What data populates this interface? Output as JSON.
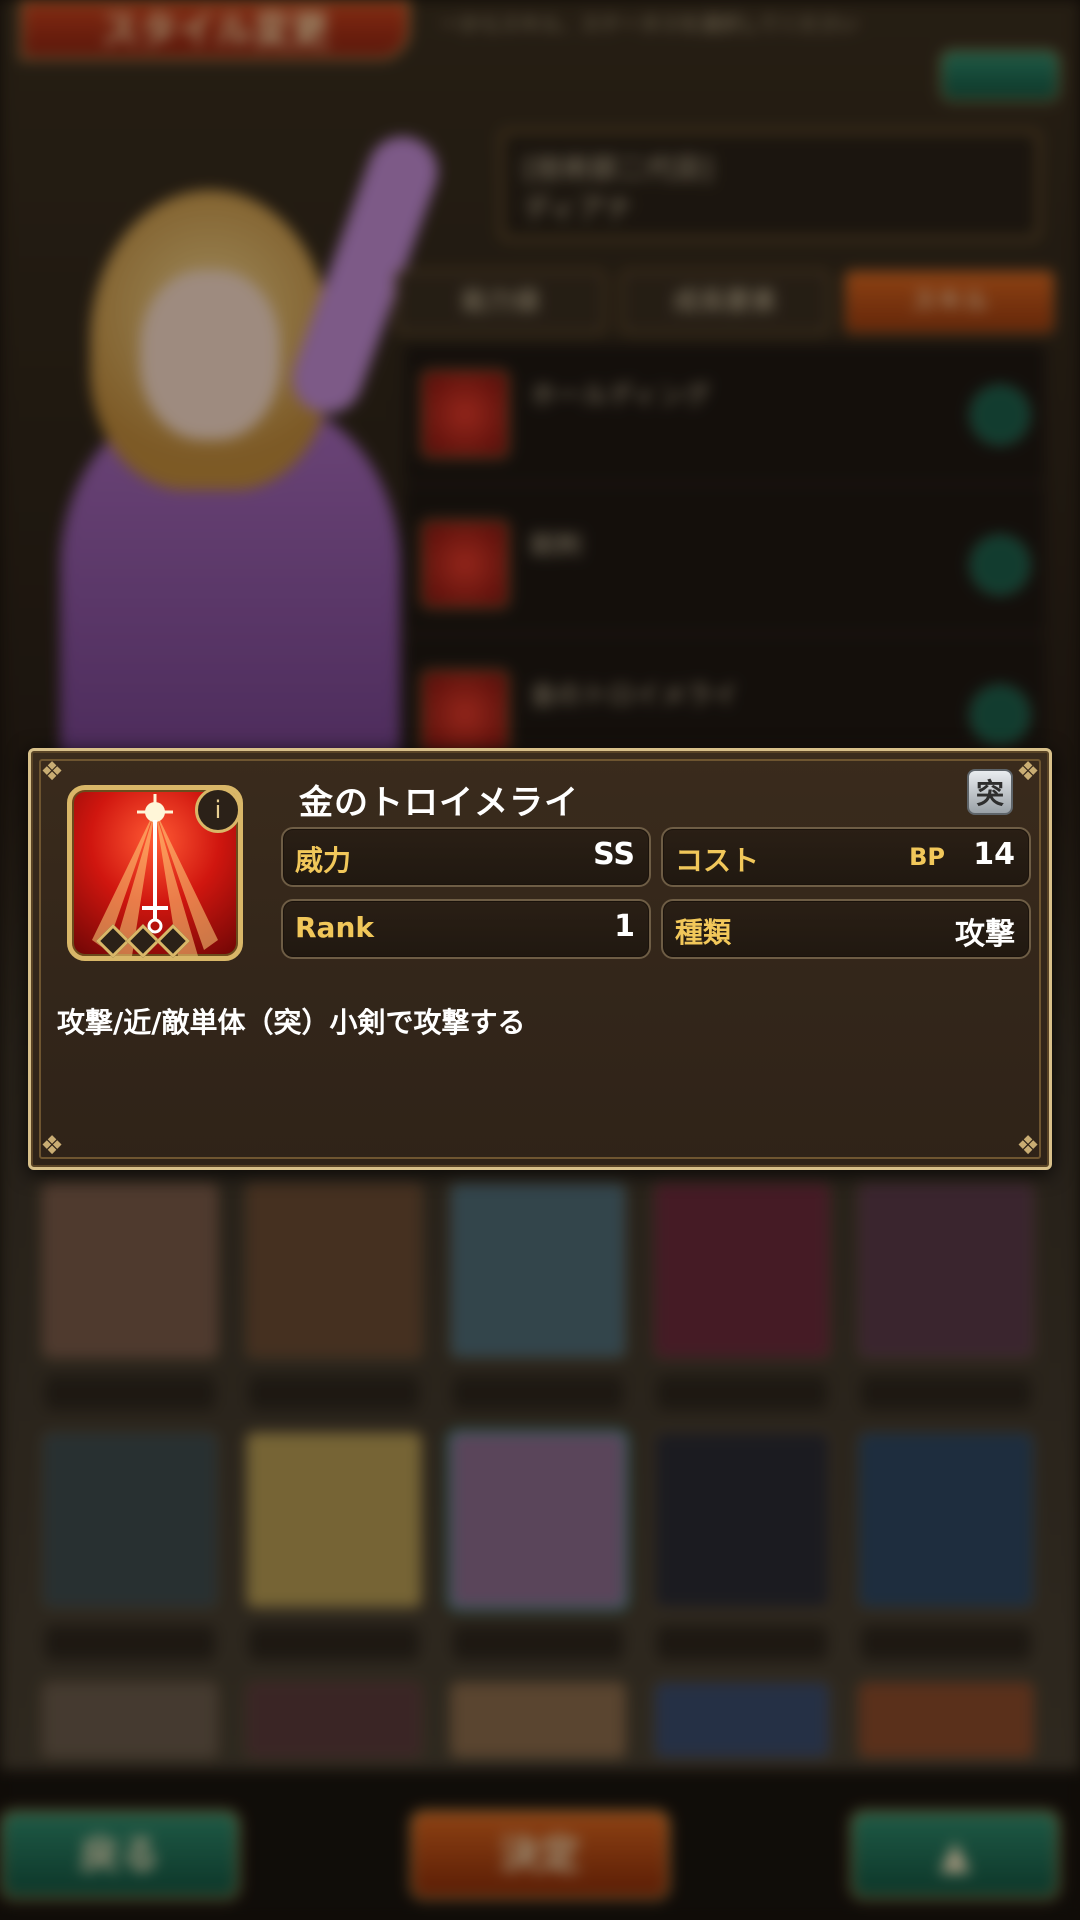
{
  "screen": {
    "title": "スタイル変更",
    "top_hint": "ーからスキル、ステータスを選択してください",
    "character": {
      "epithet": "[技術部二代目]",
      "name": "ディアナ"
    },
    "tabs": [
      {
        "label": "能力値"
      },
      {
        "label": "成長要素"
      },
      {
        "label": "スキル",
        "active": true
      }
    ],
    "skill_list": [
      {
        "name": "ホールディング"
      },
      {
        "name": "鋭刺"
      },
      {
        "name": "金のトロイメライ"
      }
    ],
    "buttons": {
      "back": "戻る",
      "confirm": "決定"
    }
  },
  "popup": {
    "skill_name": "金のトロイメライ",
    "attribute_badge": "突",
    "weapon_badge": "ⅰ",
    "power_label": "威力",
    "power_value": "SS",
    "cost_label": "コスト",
    "cost_unit": "BP",
    "cost_value": "14",
    "rank_label": "Rank",
    "rank_value": "1",
    "type_label": "種類",
    "type_value": "攻撃",
    "rank_diamonds": 3,
    "description": "攻撃/近/敵単体（突）小剣で攻撃する"
  },
  "colors": {
    "popup_border": "#d8c08a",
    "label_gold": "#f1c75a",
    "skill_icon_red": "#d0160f"
  }
}
